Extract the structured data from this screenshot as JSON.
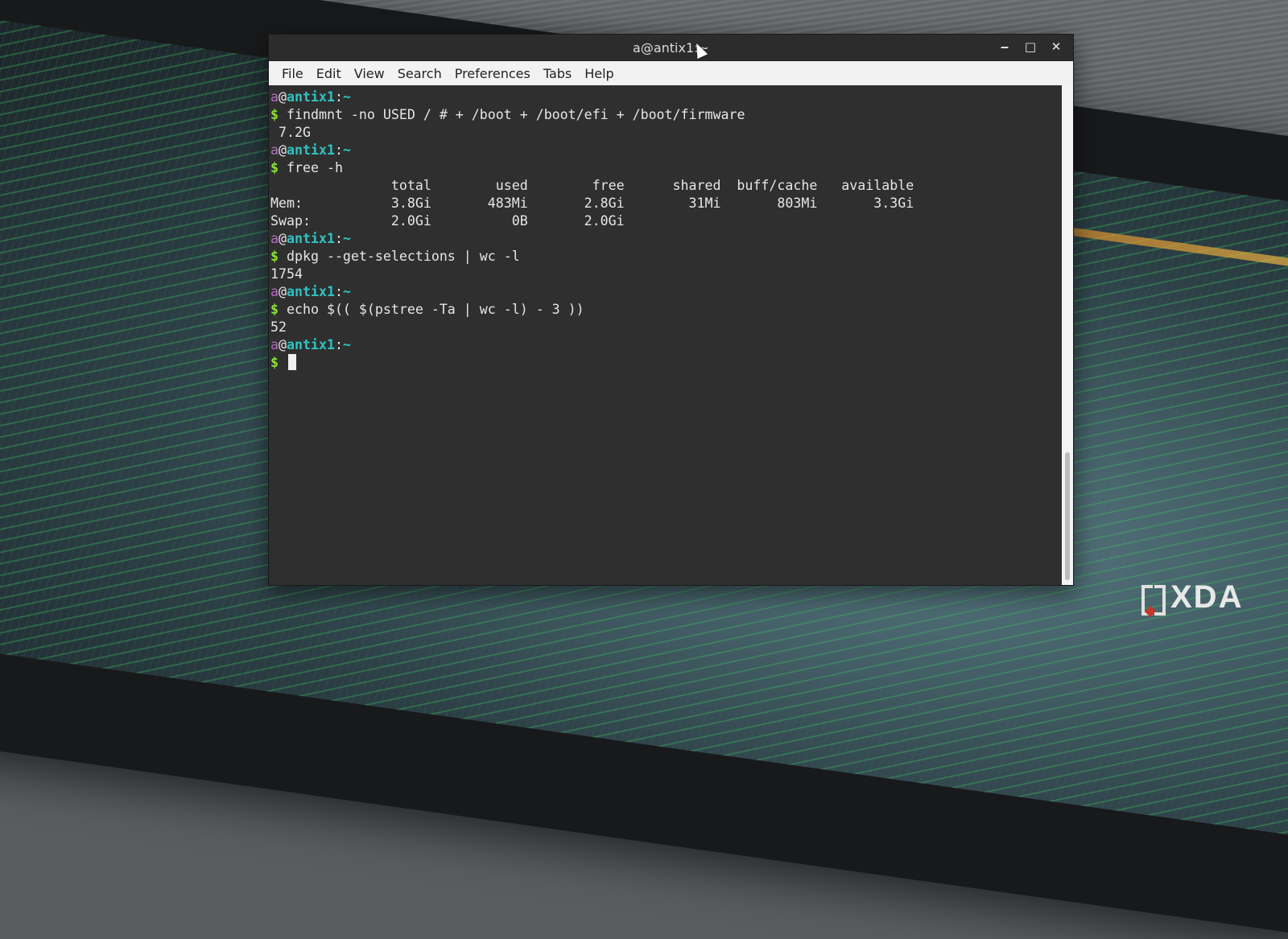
{
  "window": {
    "title": "a@antix1:~",
    "buttons": {
      "minimize": "‒",
      "maximize": "□",
      "close": "✕"
    }
  },
  "menubar": [
    "File",
    "Edit",
    "View",
    "Search",
    "Preferences",
    "Tabs",
    "Help"
  ],
  "prompt": {
    "user": "a",
    "at": "@",
    "host": "antix1",
    "colon": ":",
    "dir": "~",
    "dollar": "$"
  },
  "terminal_lines": [
    {
      "type": "prompt"
    },
    {
      "type": "cmd",
      "text": "findmnt -no USED / # + /boot + /boot/efi + /boot/firmware"
    },
    {
      "type": "out",
      "text": " 7.2G"
    },
    {
      "type": "prompt"
    },
    {
      "type": "cmd",
      "text": "free -h"
    },
    {
      "type": "out",
      "text": "               total        used        free      shared  buff/cache   available"
    },
    {
      "type": "out",
      "text": "Mem:           3.8Gi       483Mi       2.8Gi        31Mi       803Mi       3.3Gi"
    },
    {
      "type": "out",
      "text": "Swap:          2.0Gi          0B       2.0Gi"
    },
    {
      "type": "prompt"
    },
    {
      "type": "cmd",
      "text": "dpkg --get-selections | wc -l"
    },
    {
      "type": "out",
      "text": "1754"
    },
    {
      "type": "prompt"
    },
    {
      "type": "cmd",
      "text": "echo $(( $(pstree -Ta | wc -l) - 3 ))"
    },
    {
      "type": "out",
      "text": "52"
    },
    {
      "type": "prompt"
    },
    {
      "type": "input",
      "text": ""
    }
  ],
  "logo": {
    "text": "XDA"
  },
  "colors": {
    "user": "#b26ebe",
    "host": "#2ec4c4",
    "dollar": "#8ae234",
    "terminal_bg": "#2f2f2f",
    "menubar_bg": "#f2f2f2",
    "logo_accent": "#c0392b"
  }
}
